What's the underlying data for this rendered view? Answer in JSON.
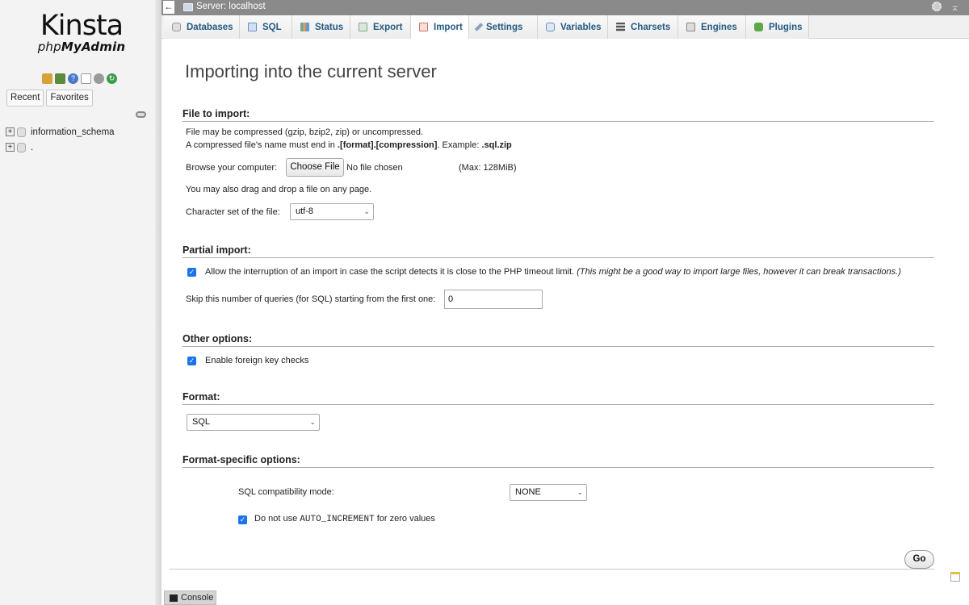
{
  "sidebar": {
    "logo_main": "Kinsta",
    "logo_sub_prefix": "php",
    "logo_sub_bold": "MyAdmin",
    "nav_icons": [
      "home-icon",
      "exit-icon",
      "help-icon",
      "documentation-icon",
      "settings-icon",
      "reload-icon"
    ],
    "tabs": {
      "recent": "Recent",
      "favorites": "Favorites"
    },
    "databases": [
      {
        "name": "information_schema"
      },
      {
        "name": "."
      }
    ]
  },
  "topbar": {
    "back": "←",
    "title": "Server: localhost",
    "collapse": "⌅"
  },
  "tabs": [
    {
      "label": "Databases",
      "icon": "database-icon"
    },
    {
      "label": "SQL",
      "icon": "sql-icon"
    },
    {
      "label": "Status",
      "icon": "status-icon"
    },
    {
      "label": "Export",
      "icon": "export-icon"
    },
    {
      "label": "Import",
      "icon": "import-icon",
      "active": true
    },
    {
      "label": "Settings",
      "icon": "wrench-icon"
    },
    {
      "label": "Variables",
      "icon": "variables-icon"
    },
    {
      "label": "Charsets",
      "icon": "charsets-icon"
    },
    {
      "label": "Engines",
      "icon": "engines-icon"
    },
    {
      "label": "Plugins",
      "icon": "plugins-icon"
    }
  ],
  "page": {
    "title": "Importing into the current server",
    "file_section": {
      "heading": "File to import:",
      "line1": "File may be compressed (gzip, bzip2, zip) or uncompressed.",
      "line2_prefix": "A compressed file's name must end in ",
      "line2_bold": ".[format].[compression]",
      "line2_mid": ". Example: ",
      "line2_example": ".sql.zip",
      "browse_label": "Browse your computer:",
      "choose_file": "Choose File",
      "no_file": "No file chosen",
      "max_size": "(Max: 128MiB)",
      "drag_hint": "You may also drag and drop a file on any page.",
      "charset_label": "Character set of the file:",
      "charset_value": "utf-8"
    },
    "partial_section": {
      "heading": "Partial import:",
      "interrupt_label": "Allow the interruption of an import in case the script detects it is close to the PHP timeout limit.",
      "interrupt_note": "(This might be a good way to import large files, however it can break transactions.)",
      "interrupt_checked": true,
      "skip_label": "Skip this number of queries (for SQL) starting from the first one:",
      "skip_value": "0"
    },
    "other_section": {
      "heading": "Other options:",
      "fk_label": "Enable foreign key checks",
      "fk_checked": true
    },
    "format_section": {
      "heading": "Format:",
      "format_value": "SQL"
    },
    "format_specific": {
      "heading": "Format-specific options:",
      "compat_label": "SQL compatibility mode:",
      "compat_value": "NONE",
      "auto_inc_prefix": "Do not use ",
      "auto_inc_code": "AUTO_INCREMENT",
      "auto_inc_suffix": " for zero values",
      "auto_inc_checked": true
    },
    "go_button": "Go"
  },
  "console": {
    "label": "Console"
  },
  "colors": {
    "tab_text": "#235a81",
    "topbar_bg": "#8a8a8a",
    "checkbox": "#1a73e8"
  }
}
